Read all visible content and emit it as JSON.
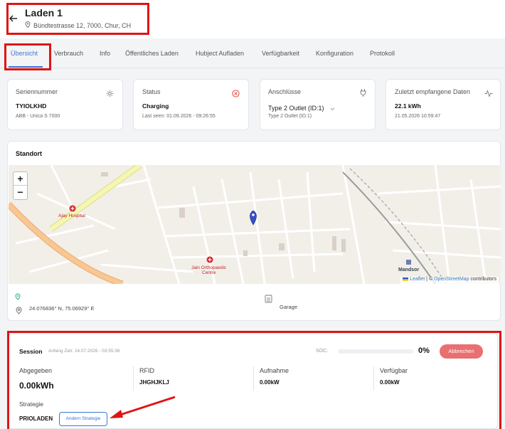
{
  "header": {
    "title": "Laden 1",
    "address": "Bündtestrasse 12, 7000, Chur, CH"
  },
  "tabs": [
    {
      "label": "Übersicht",
      "active": true
    },
    {
      "label": "Verbrauch"
    },
    {
      "label": "Info"
    },
    {
      "label": "Öffentliches Laden"
    },
    {
      "label": "Hubject Aufladen"
    },
    {
      "label": "Verfügbarkeit"
    },
    {
      "label": "Konfiguration"
    },
    {
      "label": "Protokoll"
    }
  ],
  "cards": {
    "serial": {
      "label": "Seriennummer",
      "value": "TYIOLKHD",
      "sub": "ABB - Unica S 7000",
      "icon": "gear-icon"
    },
    "status": {
      "label": "Status",
      "value": "Charging",
      "sub": "Last seen: 01.09.2026 - 09:26:55",
      "icon": "close-circle-icon"
    },
    "connectors": {
      "label": "Anschlüsse",
      "value": "Type 2 Outlet (ID:1)",
      "sub": "Type 2 Outlet (ID:1)",
      "icon": "plug-icon"
    },
    "last_data": {
      "label": "Zuletzt empfangene Daten",
      "value": "22.1 kWh",
      "sub": "21.05.2026 10:59:47",
      "icon": "activity-icon"
    }
  },
  "location": {
    "title": "Standort",
    "coords": "24.076836° N, 75.06929° E",
    "parking": "Garage",
    "map_labels": {
      "hospital": "Ajay Hospital",
      "ortho_line1": "Jain Orthopaedic",
      "ortho_line2": "Centre",
      "station": "Mandsor"
    },
    "attribution": {
      "leaflet": "Leaflet",
      "sep": " | © ",
      "osm": "OpenStreetMap",
      "suffix": " contributors"
    },
    "zoom_in": "+",
    "zoom_out": "−"
  },
  "session": {
    "title": "Session",
    "start": "Anfang Zeit: 24.07.2026 - 03:55:36",
    "soc_label": "SOC:",
    "soc_value": "0%",
    "soc_fraction": 0,
    "cancel_label": "Abbrechen",
    "delivered_label": "Abgegeben",
    "delivered_value": "0.00kWh",
    "rfid_label": "RFID",
    "rfid_value": "JHGHJKLJ",
    "recording_label": "Aufnahme",
    "recording_value": "0.00kW",
    "available_label": "Verfügbar",
    "available_value": "0.00kW",
    "strategy_label": "Strategie",
    "strategy_value": "PRIOLADEN",
    "change_strategy_label": "Andern Strategie"
  },
  "colors": {
    "accent": "#3b76d8",
    "highlight": "#e01414",
    "cancel_button": "#e96f70",
    "status_icon": "#e0443e"
  }
}
